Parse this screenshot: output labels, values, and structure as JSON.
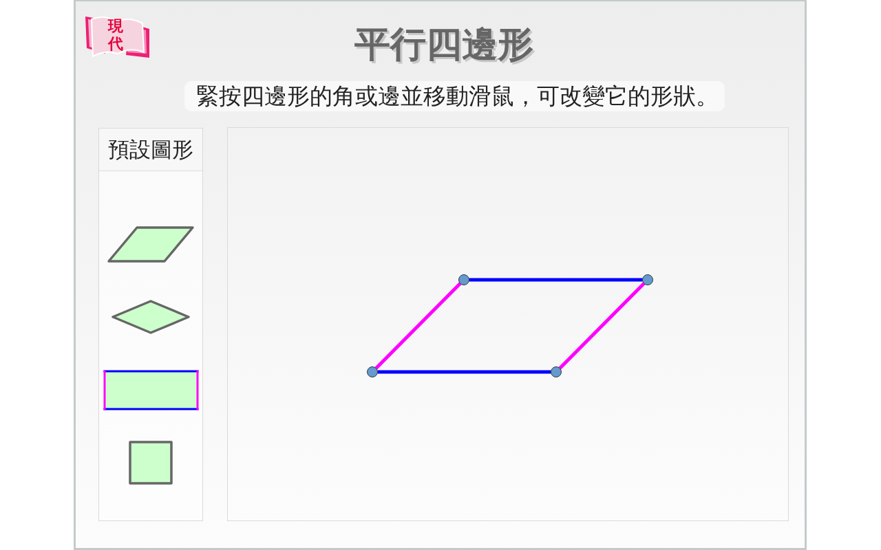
{
  "logo": {
    "text": "現代"
  },
  "title": "平行四邊形",
  "instruction": "緊按四邊形的角或邊並移動滑鼠，可改變它的形狀。",
  "presets": {
    "heading": "預設圖形",
    "shapes": [
      {
        "kind": "parallelogram",
        "highlighted": false
      },
      {
        "kind": "rhombus",
        "highlighted": false
      },
      {
        "kind": "rectangle",
        "highlighted": true
      },
      {
        "kind": "square",
        "highlighted": false
      }
    ]
  },
  "canvas": {
    "kind": "parallelogram"
  }
}
